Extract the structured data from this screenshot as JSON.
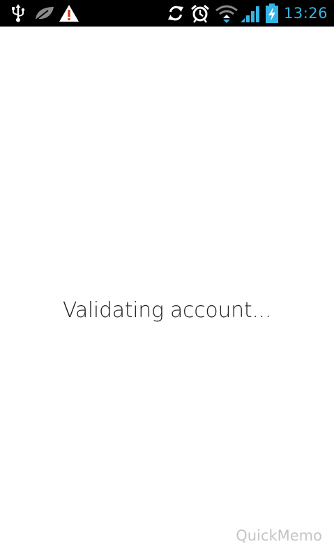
{
  "status_bar": {
    "left_icons": [
      "usb-icon",
      "leaf-icon",
      "warning-icon"
    ],
    "right_icons": [
      "sync-icon",
      "alarm-icon",
      "wifi-icon",
      "signal-icon",
      "battery-charging-icon"
    ],
    "time": "13:26",
    "accent_color": "#33b5e5"
  },
  "main": {
    "message": "Validating account..."
  },
  "watermark": {
    "text": "QuickMemo"
  }
}
